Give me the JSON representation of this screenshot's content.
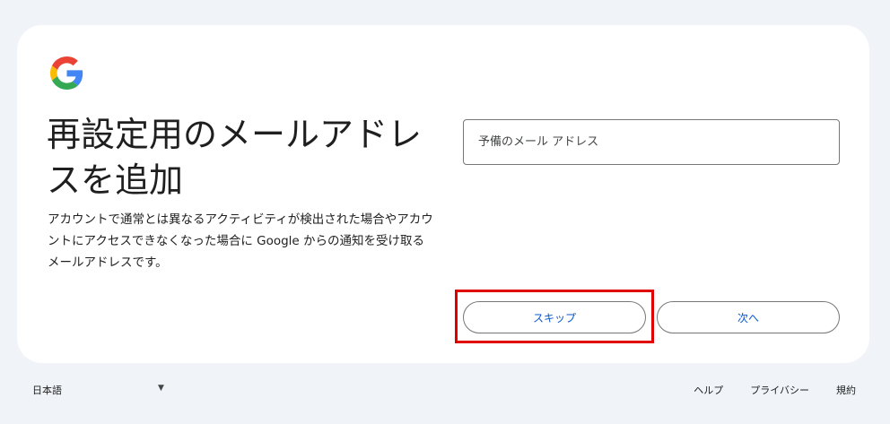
{
  "card": {
    "title": "再設定用のメールアドレスを追加",
    "description": "アカウントで通常とは異なるアクティビティが検出された場合やアカウントにアクセスできなくなった場合に Google からの通知を受け取るメールアドレスです。",
    "email_field": {
      "placeholder": "予備のメール アドレス",
      "value": ""
    },
    "buttons": {
      "skip_label": "スキップ",
      "next_label": "次へ"
    }
  },
  "footer": {
    "language": "日本語",
    "links": [
      "ヘルプ",
      "プライバシー",
      "規約"
    ]
  },
  "colors": {
    "background": "#f0f4f9",
    "card": "#ffffff",
    "accent": "#0b57d0",
    "highlight": "#e00000"
  }
}
